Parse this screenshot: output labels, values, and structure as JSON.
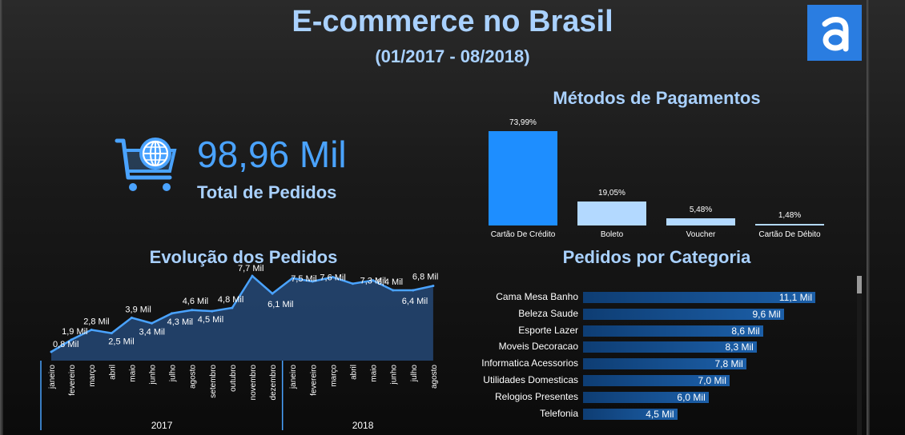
{
  "header": {
    "title": "E-commerce no Brasil",
    "subtitle": "(01/2017 - 08/2018)"
  },
  "kpi": {
    "value": "98,96 Mil",
    "label": "Total de Pedidos",
    "icon": "shopping-cart-globe-icon"
  },
  "payments": {
    "title": "Métodos de Pagamentos",
    "items": [
      {
        "label": "Cartão De Crédito",
        "value_label": "73,99%"
      },
      {
        "label": "Boleto",
        "value_label": "19,05%"
      },
      {
        "label": "Voucher",
        "value_label": "5,48%"
      },
      {
        "label": "Cartão De Débito",
        "value_label": "1,48%"
      }
    ]
  },
  "evolution": {
    "title": "Evolução dos Pedidos",
    "months_2017": [
      "janeiro",
      "fevereiro",
      "março",
      "abril",
      "maio",
      "junho",
      "julho",
      "agosto",
      "setembro",
      "outubro",
      "novembro",
      "dezembro"
    ],
    "months_2018": [
      "janeiro",
      "fevereiro",
      "março",
      "abril",
      "maio",
      "junho",
      "julho",
      "agosto"
    ],
    "years": [
      "2017",
      "2018"
    ],
    "data_labels": [
      "0,8 Mil",
      "1,9 Mil",
      "2,8 Mil",
      "2,5 Mil",
      "3,9 Mil",
      "3,4 Mil",
      "4,3 Mil",
      "4,6 Mil",
      "4,5 Mil",
      "4,8 Mil",
      "7,7 Mil",
      "6,1 Mil",
      "7,5 Mil",
      "7,6 Mil",
      "7,3 Mil",
      "6,4 Mil",
      "6,4 Mil",
      "6,8 Mil"
    ]
  },
  "categories": {
    "title": "Pedidos por Categoria",
    "items": [
      {
        "label": "Cama Mesa Banho",
        "value_label": "11,1 Mil"
      },
      {
        "label": "Beleza Saude",
        "value_label": "9,6 Mil"
      },
      {
        "label": "Esporte Lazer",
        "value_label": "8,6 Mil"
      },
      {
        "label": "Moveis Decoracao",
        "value_label": "8,3 Mil"
      },
      {
        "label": "Informatica Acessorios",
        "value_label": "7,8 Mil"
      },
      {
        "label": "Utilidades Domesticas",
        "value_label": "7,0 Mil"
      },
      {
        "label": "Relogios Presentes",
        "value_label": "6,0 Mil"
      },
      {
        "label": "Telefonia",
        "value_label": "4,5 Mil"
      }
    ]
  },
  "colors": {
    "accent": "#a9d1ff",
    "bar": "#1e8eff",
    "area": "#23426b",
    "logo": "#2a7de1"
  },
  "chart_data": [
    {
      "type": "bar",
      "title": "Métodos de Pagamentos",
      "categories": [
        "Cartão De Crédito",
        "Boleto",
        "Voucher",
        "Cartão De Débito"
      ],
      "values": [
        73.99,
        19.05,
        5.48,
        1.48
      ],
      "colors": [
        "#1e8eff",
        "#b3d9ff",
        "#b3d9ff",
        "#b3d9ff"
      ]
    },
    {
      "type": "area",
      "title": "Evolução dos Pedidos",
      "x": [
        "2017-01",
        "2017-02",
        "2017-03",
        "2017-04",
        "2017-05",
        "2017-06",
        "2017-07",
        "2017-08",
        "2017-09",
        "2017-10",
        "2017-11",
        "2017-12",
        "2018-01",
        "2018-02",
        "2018-03",
        "2018-04",
        "2018-05",
        "2018-06",
        "2018-07",
        "2018-08"
      ],
      "values": [
        0.8,
        1.9,
        2.8,
        2.5,
        3.9,
        3.4,
        4.3,
        4.6,
        4.5,
        4.8,
        7.7,
        6.1,
        7.5,
        7.2,
        7.6,
        7.0,
        7.3,
        6.4,
        6.4,
        6.8
      ],
      "ylim": [
        0,
        8
      ]
    },
    {
      "type": "bar",
      "title": "Pedidos por Categoria",
      "categories": [
        "Cama Mesa Banho",
        "Beleza Saude",
        "Esporte Lazer",
        "Moveis Decoracao",
        "Informatica Acessorios",
        "Utilidades Domesticas",
        "Relogios Presentes",
        "Telefonia"
      ],
      "values": [
        11.1,
        9.6,
        8.6,
        8.3,
        7.8,
        7.0,
        6.0,
        4.5
      ]
    }
  ]
}
